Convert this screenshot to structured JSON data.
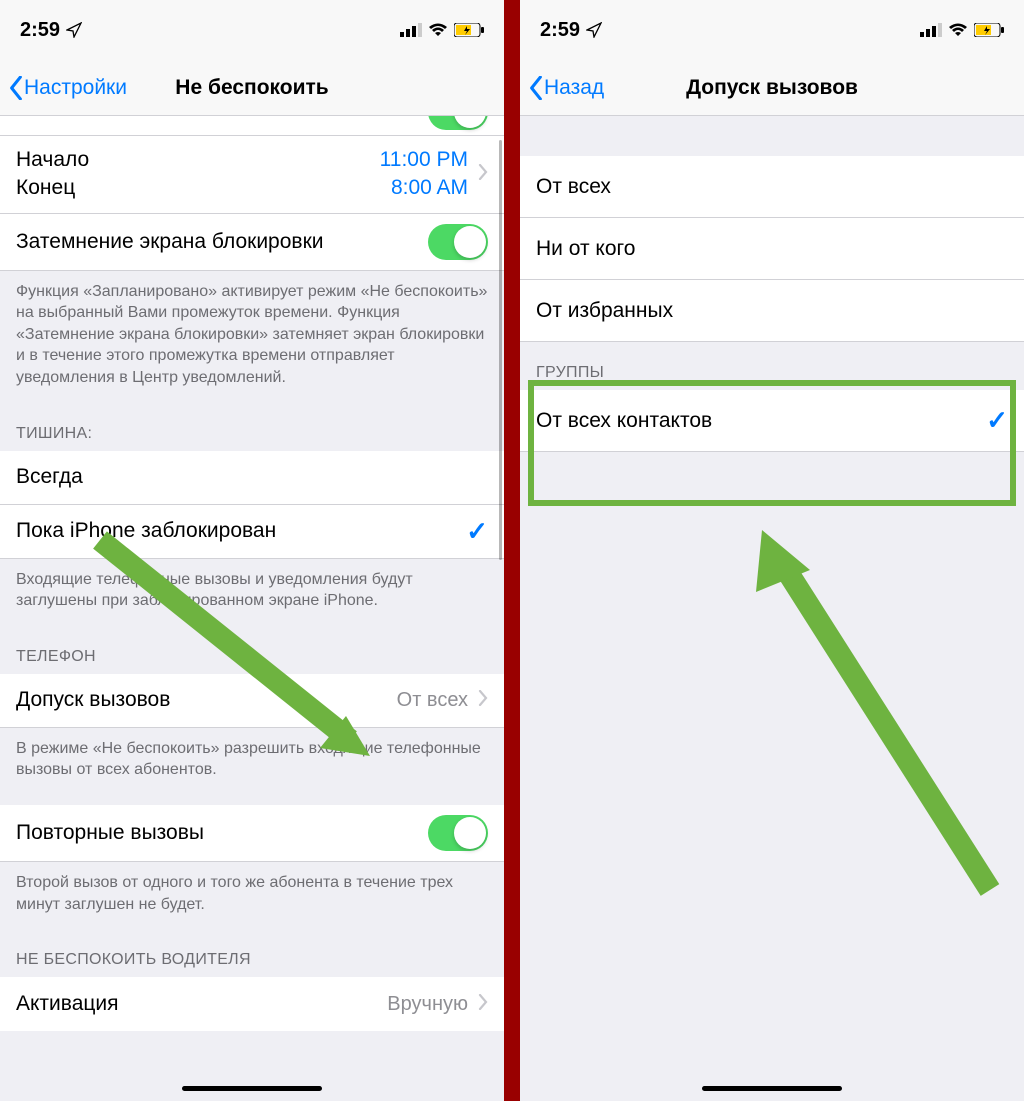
{
  "status": {
    "time": "2:59"
  },
  "left": {
    "nav_back": "Настройки",
    "nav_title": "Не беспокоить",
    "start_label": "Начало",
    "start_value": "11:00 PM",
    "end_label": "Конец",
    "end_value": "8:00 AM",
    "dim_label": "Затемнение экрана блокировки",
    "dim_footer": "Функция «Запланировано» активирует режим «Не беспокоить» на выбранный Вами промежуток времени. Функция «Затемнение экрана блокировки» затемняет экран блокировки и в течение этого промежутка времени отправляет уведомления в Центр уведомлений.",
    "silence_header": "ТИШИНА:",
    "silence_always": "Всегда",
    "silence_locked": "Пока iPhone заблокирован",
    "silence_footer": "Входящие телефонные вызовы и уведомления будут заглушены при заблокированном экране iPhone.",
    "phone_header": "ТЕЛЕФОН",
    "allow_calls_label": "Допуск вызовов",
    "allow_calls_value": "От всех",
    "allow_calls_footer": "В режиме «Не беспокоить» разрешить входящие телефонные вызовы от всех абонентов.",
    "repeated_label": "Повторные вызовы",
    "repeated_footer": "Второй вызов от одного и того же абонента в течение трех минут заглушен не будет.",
    "driver_header": "НЕ БЕСПОКОИТЬ ВОДИТЕЛЯ",
    "activation_label": "Активация",
    "activation_value": "Вручную"
  },
  "right": {
    "nav_back": "Назад",
    "nav_title": "Допуск вызовов",
    "opt_everyone": "От всех",
    "opt_noone": "Ни от кого",
    "opt_favorites": "От избранных",
    "groups_header": "ГРУППЫ",
    "opt_all_contacts": "От всех контактов"
  }
}
